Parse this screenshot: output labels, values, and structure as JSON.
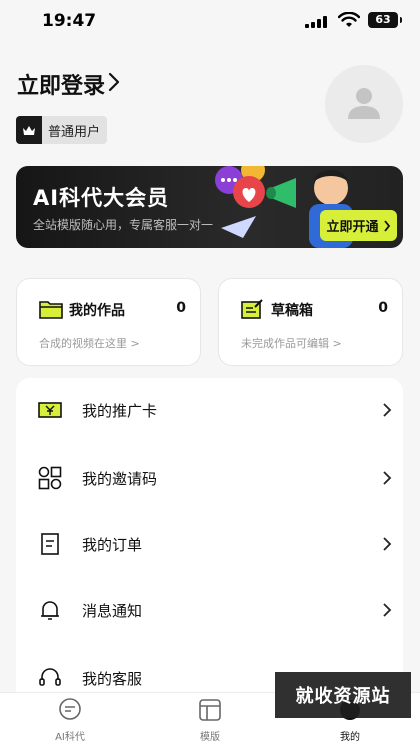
{
  "status_bar": {
    "time": "19:47",
    "battery": "63"
  },
  "header": {
    "login_label": "立即登录"
  },
  "badge": {
    "label": "普通用户"
  },
  "vip": {
    "title": "AI科代大会员",
    "subtitle": "全站模版随心用，专属客服一对一",
    "button_label": "立即开通"
  },
  "cards": [
    {
      "title": "我的作品",
      "count": "0",
      "subtitle": "合成的视频在这里 >"
    },
    {
      "title": "草稿箱",
      "count": "0",
      "subtitle": "未完成作品可编辑 >"
    }
  ],
  "menu": {
    "items": [
      {
        "label": "我的推广卡",
        "icon": "promo-card-icon"
      },
      {
        "label": "我的邀请码",
        "icon": "qr-code-icon"
      },
      {
        "label": "我的订单",
        "icon": "order-icon"
      },
      {
        "label": "消息通知",
        "icon": "bell-icon"
      },
      {
        "label": "我的客服",
        "icon": "headset-icon"
      }
    ]
  },
  "tabbar": {
    "tabs": [
      {
        "label": "AI科代",
        "icon": "chat-icon",
        "active": false
      },
      {
        "label": "模版",
        "icon": "template-icon",
        "active": false
      },
      {
        "label": "我的",
        "icon": "profile-icon",
        "active": true
      }
    ]
  },
  "watermark": "就收资源站",
  "colors": {
    "accent": "#d8ef3a",
    "banner_bg": "#1c1c1c",
    "page_bg": "#f6f6f6"
  }
}
